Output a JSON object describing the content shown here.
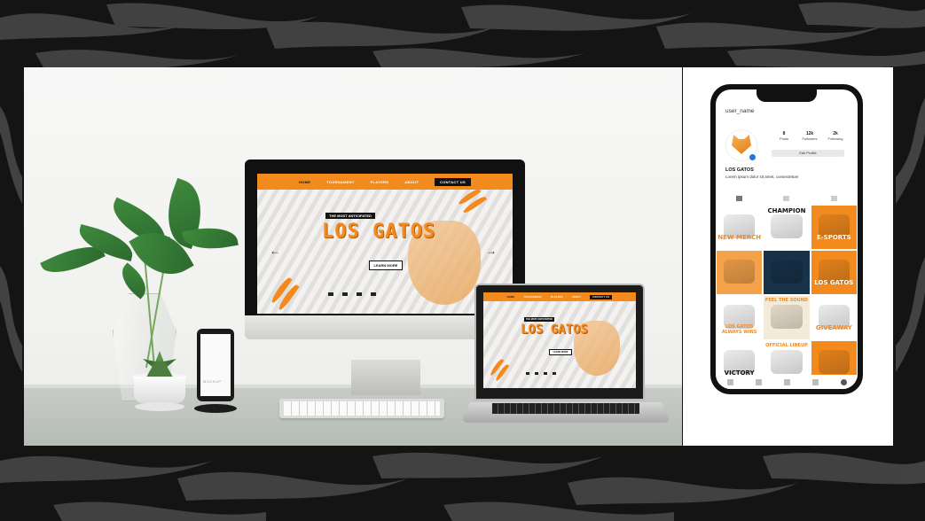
{
  "colors": {
    "brand_orange": "#f28a1e",
    "dark": "#111111",
    "desk": "#bcc1bc"
  },
  "website": {
    "nav": [
      "HOME",
      "TOURNAMENT",
      "PLAYERS",
      "ABOUT"
    ],
    "contact": "CONTACT US",
    "tagline": "THE MOST ANTICIPATED",
    "title": "LOS GATOS",
    "button": "LEARN MORE",
    "prev_icon": "arrow-left-icon",
    "next_icon": "arrow-right-icon"
  },
  "desk_phone": {
    "label": "MOCKUP"
  },
  "instagram": {
    "username": "user_name",
    "stats": [
      {
        "value": "8",
        "label": "Posts"
      },
      {
        "value": "12k",
        "label": "Followers"
      },
      {
        "value": "2k",
        "label": "Following"
      }
    ],
    "edit_profile": "Edit Profile",
    "name": "LOS GATOS",
    "bio": "Lorem ipsum dolor sit amet, consectetuer",
    "grid": [
      {
        "text": "NEW MERCH",
        "bg": "#ffffff",
        "fg": "#f28a1e"
      },
      {
        "text": "CHAMPION",
        "bg": "#ffffff",
        "fg": "#111111"
      },
      {
        "text": "E-SPORTS",
        "bg": "#f28a1e",
        "fg": "#ffffff"
      },
      {
        "text": "",
        "bg": "#f3a24a",
        "fg": "#ffffff"
      },
      {
        "text": "",
        "bg": "#18324a",
        "fg": "#ffffff"
      },
      {
        "text": "LOS GATOS",
        "bg": "#f28a1e",
        "fg": "#ffffff"
      },
      {
        "text": "LOS GATOS ALWAYS WINS",
        "bg": "#ffffff",
        "fg": "#f28a1e"
      },
      {
        "text": "FEEL THE SOUND",
        "bg": "#f4ead8",
        "fg": "#f28a1e"
      },
      {
        "text": "GIVEAWAY",
        "bg": "#ffffff",
        "fg": "#f28a1e"
      },
      {
        "text": "VICTORY",
        "bg": "#ffffff",
        "fg": "#111111"
      },
      {
        "text": "OFFICIAL LINEUP",
        "bg": "#ffffff",
        "fg": "#f28a1e"
      },
      {
        "text": "",
        "bg": "#f28a1e",
        "fg": "#ffffff"
      }
    ]
  }
}
